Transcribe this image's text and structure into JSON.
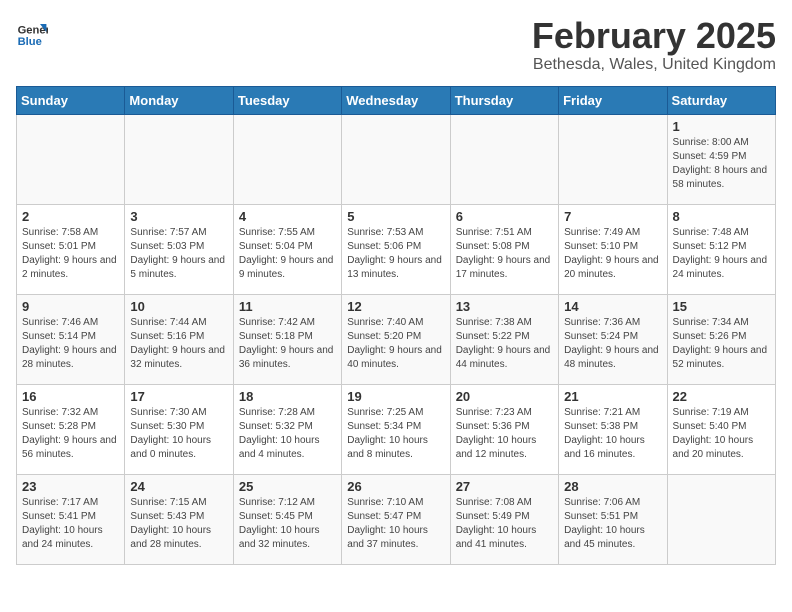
{
  "header": {
    "logo_line1": "General",
    "logo_line2": "Blue",
    "title": "February 2025",
    "subtitle": "Bethesda, Wales, United Kingdom"
  },
  "days_of_week": [
    "Sunday",
    "Monday",
    "Tuesday",
    "Wednesday",
    "Thursday",
    "Friday",
    "Saturday"
  ],
  "weeks": [
    [
      {
        "num": "",
        "info": ""
      },
      {
        "num": "",
        "info": ""
      },
      {
        "num": "",
        "info": ""
      },
      {
        "num": "",
        "info": ""
      },
      {
        "num": "",
        "info": ""
      },
      {
        "num": "",
        "info": ""
      },
      {
        "num": "1",
        "info": "Sunrise: 8:00 AM\nSunset: 4:59 PM\nDaylight: 8 hours and 58 minutes."
      }
    ],
    [
      {
        "num": "2",
        "info": "Sunrise: 7:58 AM\nSunset: 5:01 PM\nDaylight: 9 hours and 2 minutes."
      },
      {
        "num": "3",
        "info": "Sunrise: 7:57 AM\nSunset: 5:03 PM\nDaylight: 9 hours and 5 minutes."
      },
      {
        "num": "4",
        "info": "Sunrise: 7:55 AM\nSunset: 5:04 PM\nDaylight: 9 hours and 9 minutes."
      },
      {
        "num": "5",
        "info": "Sunrise: 7:53 AM\nSunset: 5:06 PM\nDaylight: 9 hours and 13 minutes."
      },
      {
        "num": "6",
        "info": "Sunrise: 7:51 AM\nSunset: 5:08 PM\nDaylight: 9 hours and 17 minutes."
      },
      {
        "num": "7",
        "info": "Sunrise: 7:49 AM\nSunset: 5:10 PM\nDaylight: 9 hours and 20 minutes."
      },
      {
        "num": "8",
        "info": "Sunrise: 7:48 AM\nSunset: 5:12 PM\nDaylight: 9 hours and 24 minutes."
      }
    ],
    [
      {
        "num": "9",
        "info": "Sunrise: 7:46 AM\nSunset: 5:14 PM\nDaylight: 9 hours and 28 minutes."
      },
      {
        "num": "10",
        "info": "Sunrise: 7:44 AM\nSunset: 5:16 PM\nDaylight: 9 hours and 32 minutes."
      },
      {
        "num": "11",
        "info": "Sunrise: 7:42 AM\nSunset: 5:18 PM\nDaylight: 9 hours and 36 minutes."
      },
      {
        "num": "12",
        "info": "Sunrise: 7:40 AM\nSunset: 5:20 PM\nDaylight: 9 hours and 40 minutes."
      },
      {
        "num": "13",
        "info": "Sunrise: 7:38 AM\nSunset: 5:22 PM\nDaylight: 9 hours and 44 minutes."
      },
      {
        "num": "14",
        "info": "Sunrise: 7:36 AM\nSunset: 5:24 PM\nDaylight: 9 hours and 48 minutes."
      },
      {
        "num": "15",
        "info": "Sunrise: 7:34 AM\nSunset: 5:26 PM\nDaylight: 9 hours and 52 minutes."
      }
    ],
    [
      {
        "num": "16",
        "info": "Sunrise: 7:32 AM\nSunset: 5:28 PM\nDaylight: 9 hours and 56 minutes."
      },
      {
        "num": "17",
        "info": "Sunrise: 7:30 AM\nSunset: 5:30 PM\nDaylight: 10 hours and 0 minutes."
      },
      {
        "num": "18",
        "info": "Sunrise: 7:28 AM\nSunset: 5:32 PM\nDaylight: 10 hours and 4 minutes."
      },
      {
        "num": "19",
        "info": "Sunrise: 7:25 AM\nSunset: 5:34 PM\nDaylight: 10 hours and 8 minutes."
      },
      {
        "num": "20",
        "info": "Sunrise: 7:23 AM\nSunset: 5:36 PM\nDaylight: 10 hours and 12 minutes."
      },
      {
        "num": "21",
        "info": "Sunrise: 7:21 AM\nSunset: 5:38 PM\nDaylight: 10 hours and 16 minutes."
      },
      {
        "num": "22",
        "info": "Sunrise: 7:19 AM\nSunset: 5:40 PM\nDaylight: 10 hours and 20 minutes."
      }
    ],
    [
      {
        "num": "23",
        "info": "Sunrise: 7:17 AM\nSunset: 5:41 PM\nDaylight: 10 hours and 24 minutes."
      },
      {
        "num": "24",
        "info": "Sunrise: 7:15 AM\nSunset: 5:43 PM\nDaylight: 10 hours and 28 minutes."
      },
      {
        "num": "25",
        "info": "Sunrise: 7:12 AM\nSunset: 5:45 PM\nDaylight: 10 hours and 32 minutes."
      },
      {
        "num": "26",
        "info": "Sunrise: 7:10 AM\nSunset: 5:47 PM\nDaylight: 10 hours and 37 minutes."
      },
      {
        "num": "27",
        "info": "Sunrise: 7:08 AM\nSunset: 5:49 PM\nDaylight: 10 hours and 41 minutes."
      },
      {
        "num": "28",
        "info": "Sunrise: 7:06 AM\nSunset: 5:51 PM\nDaylight: 10 hours and 45 minutes."
      },
      {
        "num": "",
        "info": ""
      }
    ]
  ]
}
